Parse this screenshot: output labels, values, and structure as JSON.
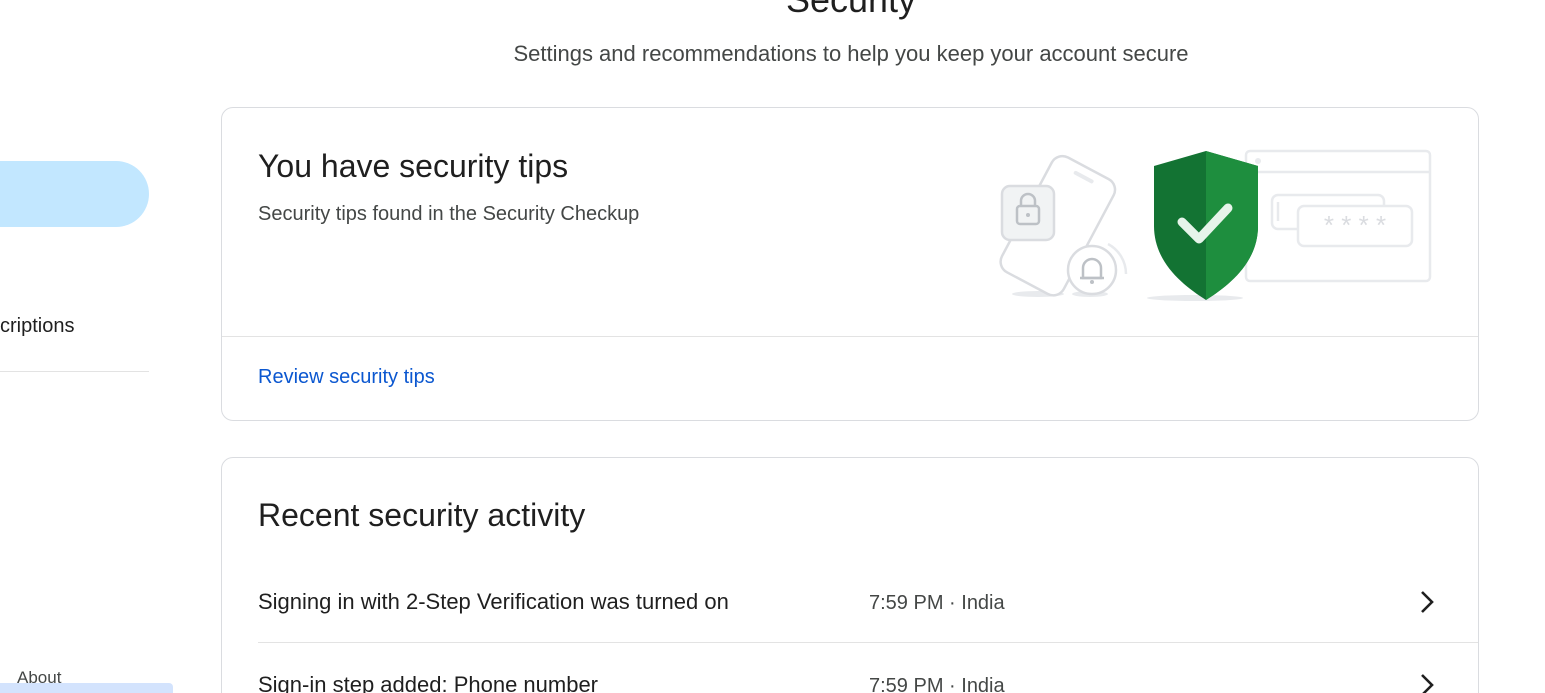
{
  "header": {
    "title": "Security",
    "subtitle": "Settings and recommendations to help you keep your account secure"
  },
  "sidebar": {
    "visible_item_label": "criptions",
    "footer_link": "About"
  },
  "security_tips": {
    "title": "You have security tips",
    "description": "Security tips found in the Security Checkup",
    "link_label": "Review security tips",
    "illustration_icons": [
      "phone-lock-icon",
      "bell-icon",
      "shield-check-icon",
      "password-window-icon"
    ],
    "password_mask": "* * * *"
  },
  "recent_activity": {
    "title": "Recent security activity",
    "items": [
      {
        "event": "Signing in with 2-Step Verification was turned on",
        "time": "7:59 PM · India"
      },
      {
        "event": "Sign-in step added: Phone number",
        "time": "7:59 PM · India"
      }
    ]
  },
  "colors": {
    "accent": "#0b57d0",
    "nav_active": "#c2e7ff",
    "shield_dark": "#137333",
    "shield_light": "#1e8e3e"
  }
}
